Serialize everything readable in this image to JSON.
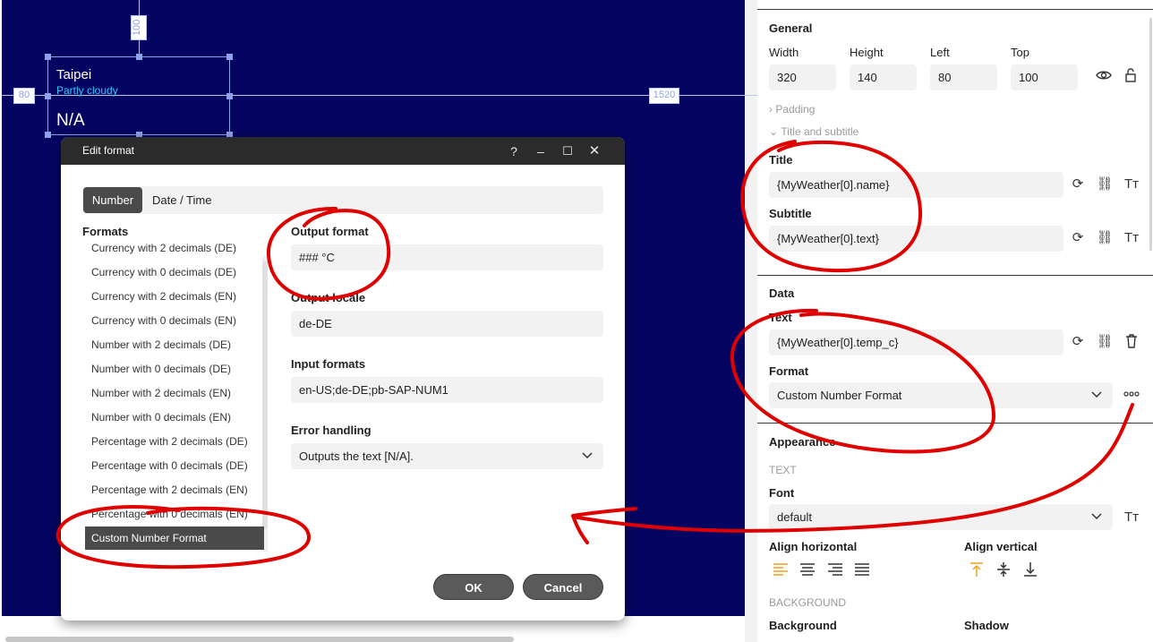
{
  "canvas": {
    "dim_top": "100",
    "dim_left": "80",
    "dim_right": "1520",
    "widget": {
      "title": "Taipei",
      "subtitle": "Partly cloudy",
      "value": "N/A"
    },
    "background_color": "#050561"
  },
  "dialog": {
    "title": "Edit format",
    "controls": {
      "help": "?",
      "minimize": "–",
      "maximize": "☐",
      "close": "✕"
    },
    "tabs": [
      {
        "label": "Number",
        "active": true
      },
      {
        "label": "Date / Time",
        "active": false
      }
    ],
    "formats_label": "Formats",
    "formats": [
      "Currency with 2 decimals (DE)",
      "Currency with 0 decimals (DE)",
      "Currency with 2 decimals (EN)",
      "Currency with 0 decimals (EN)",
      "Number with 2 decimals (DE)",
      "Number with 0 decimals (DE)",
      "Number with 2 decimals (EN)",
      "Number with 0 decimals (EN)",
      "Percentage with 2 decimals (DE)",
      "Percentage with 0 decimals (DE)",
      "Percentage with 2 decimals (EN)",
      "Percentage with 0 decimals (EN)",
      "Custom Number Format"
    ],
    "selected_format": "Custom Number Format",
    "output_format_label": "Output format",
    "output_format_value": "### °C",
    "output_locale_label": "Output locale",
    "output_locale_value": "de-DE",
    "input_formats_label": "Input formats",
    "input_formats_value": "en-US;de-DE;pb-SAP-NUM1",
    "error_handling_label": "Error handling",
    "error_handling_value": "Outputs the text [N/A].",
    "ok_label": "OK",
    "cancel_label": "Cancel"
  },
  "panel": {
    "general": {
      "title": "General",
      "width_label": "Width",
      "width_value": "320",
      "height_label": "Height",
      "height_value": "140",
      "left_label": "Left",
      "left_value": "80",
      "top_label": "Top",
      "top_value": "100",
      "padding_label": "Padding",
      "title_subtitle_label": "Title and subtitle",
      "title_label": "Title",
      "title_value": "{MyWeather[0].name}",
      "subtitle_label": "Subtitle",
      "subtitle_value": "{MyWeather[0].text}"
    },
    "data": {
      "title": "Data",
      "text_label": "Text",
      "text_value": "{MyWeather[0].temp_c}",
      "format_label": "Format",
      "format_value": "Custom Number Format",
      "more_icon": "more-dots-icon"
    },
    "appearance": {
      "title": "Appearance",
      "text_caps": "TEXT",
      "font_label": "Font",
      "font_value": "default",
      "align_horizontal_label": "Align horizontal",
      "align_vertical_label": "Align vertical",
      "background_caps": "BACKGROUND",
      "background_label": "Background",
      "shadow_label": "Shadow"
    },
    "accent_color": "#f0a020"
  },
  "annotation_color": "#e00000"
}
